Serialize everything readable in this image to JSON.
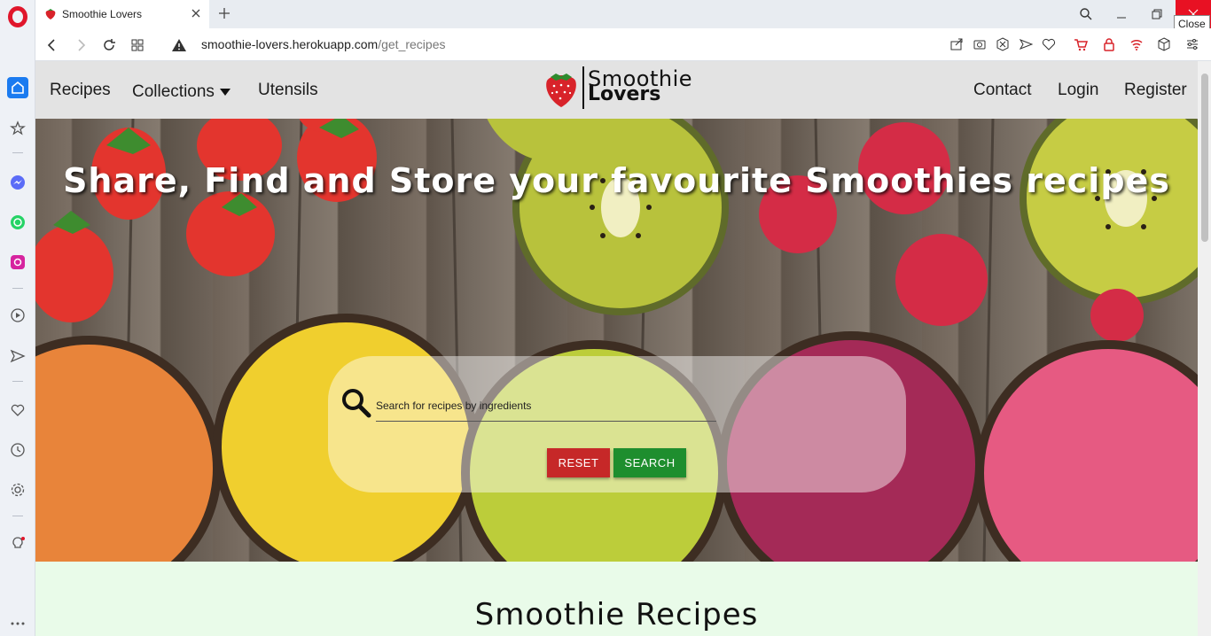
{
  "browser": {
    "tab_title": "Smoothie Lovers",
    "url_host": "smoothie-lovers.herokuapp.com",
    "url_path": "/get_recipes",
    "tooltip": "Close"
  },
  "site": {
    "nav_left": [
      "Recipes",
      "Collections",
      "Utensils"
    ],
    "nav_right": [
      "Contact",
      "Login",
      "Register"
    ],
    "logo_line1": "Smoothie",
    "logo_line2": "Lovers"
  },
  "hero": {
    "title": "Share, Find and Store your favourite Smoothies recipes",
    "search_placeholder": "Search for recipes by ingredients",
    "reset_label": "RESET",
    "search_label": "SEARCH"
  },
  "section": {
    "title": "Smoothie Recipes"
  },
  "colors": {
    "reset": "#c62828",
    "search": "#1e8e2e",
    "nav_bg": "#e3e3e3",
    "section_bg": "#e9fbe9"
  },
  "icons": {
    "sidebar": [
      "opera-icon",
      "home-icon",
      "star-icon",
      "messenger-icon",
      "whatsapp-icon",
      "instagram-icon",
      "player-icon",
      "send-icon",
      "heart-icon",
      "history-icon",
      "settings-icon",
      "bulb-icon",
      "more-icon"
    ]
  }
}
